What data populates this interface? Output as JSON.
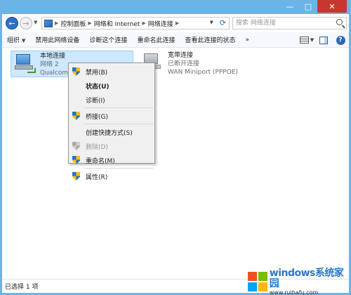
{
  "window": {
    "minimize": "—",
    "maximize": "□",
    "close": "✕"
  },
  "nav": {
    "back": "←",
    "forward": "→",
    "breadcrumb": [
      "控制面板",
      "网络和 Internet",
      "网络连接"
    ],
    "search_placeholder": "搜索 网络连接"
  },
  "toolbar": {
    "items": [
      "组织",
      "禁用此网络设备",
      "诊断这个连接",
      "重命名此连接",
      "查看此连接的状态"
    ],
    "more": "»"
  },
  "connections": [
    {
      "name": "本地连接",
      "status": "网络  2",
      "device": "Qualcomm",
      "selected": true
    },
    {
      "name": "宽带连接",
      "status": "已断开连接",
      "device": "WAN Miniport (PPPOE)",
      "selected": false
    }
  ],
  "context_menu": {
    "items": [
      {
        "label": "禁用(B)",
        "shield": true,
        "bold": false,
        "disabled": false
      },
      {
        "label": "状态(U)",
        "shield": false,
        "bold": true,
        "disabled": false
      },
      {
        "label": "诊断(I)",
        "shield": false,
        "bold": false,
        "disabled": false
      },
      {
        "label": "桥接(G)",
        "shield": true,
        "bold": false,
        "disabled": false
      },
      {
        "label": "创建快捷方式(S)",
        "shield": false,
        "bold": false,
        "disabled": false
      },
      {
        "label": "删除(D)",
        "shield": true,
        "bold": false,
        "disabled": true
      },
      {
        "label": "重命名(M)",
        "shield": true,
        "bold": false,
        "disabled": false
      },
      {
        "label": "属性(R)",
        "shield": true,
        "bold": false,
        "disabled": false
      }
    ]
  },
  "statusbar": {
    "selection": "已选择 1 项"
  },
  "watermark": {
    "brand": "windows系统家园",
    "url": "www.ruihafu.com"
  },
  "colors": {
    "titlebar": "#6cb4e8",
    "selection": "#cde8ff",
    "close": "#c7372f"
  }
}
